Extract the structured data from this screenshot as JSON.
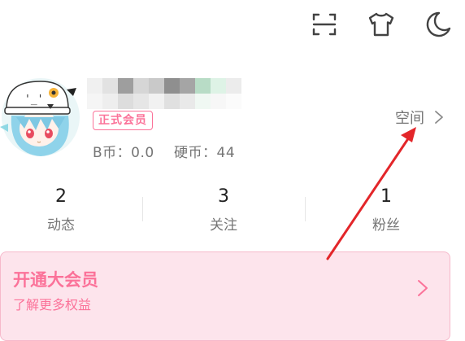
{
  "header": {
    "icons": [
      "scan-icon",
      "theme-shirt-icon",
      "night-mode-icon"
    ]
  },
  "profile": {
    "username": "",
    "badge": "正式会员",
    "bcoin": "B币：0.0",
    "coins": "硬币：44",
    "space_link": "空间"
  },
  "stats": [
    {
      "value": "2",
      "label": "动态"
    },
    {
      "value": "3",
      "label": "关注"
    },
    {
      "value": "1",
      "label": "粉丝"
    }
  ],
  "vip": {
    "title": "开通大会员",
    "subtitle": "了解更多权益"
  },
  "colors": {
    "accent_pink": "#fb7299",
    "annotation_red": "#e3262a",
    "mosaic": [
      "#f0f0f0",
      "#e2e2e2",
      "#9e9e9e",
      "#d6d6d6",
      "#c9c9c9",
      "#8f8f8f",
      "#a5a5a5",
      "#b8dcc6",
      "#def3e6",
      "#ececec",
      "#f5f5f5",
      "#eeeeee",
      "#dddddd",
      "#e6e6e6",
      "#f1f1f1",
      "#e0e0e0",
      "#e9e9e9",
      "#f0f8f3",
      "#f7f7f7",
      "#fbfbfb"
    ]
  }
}
